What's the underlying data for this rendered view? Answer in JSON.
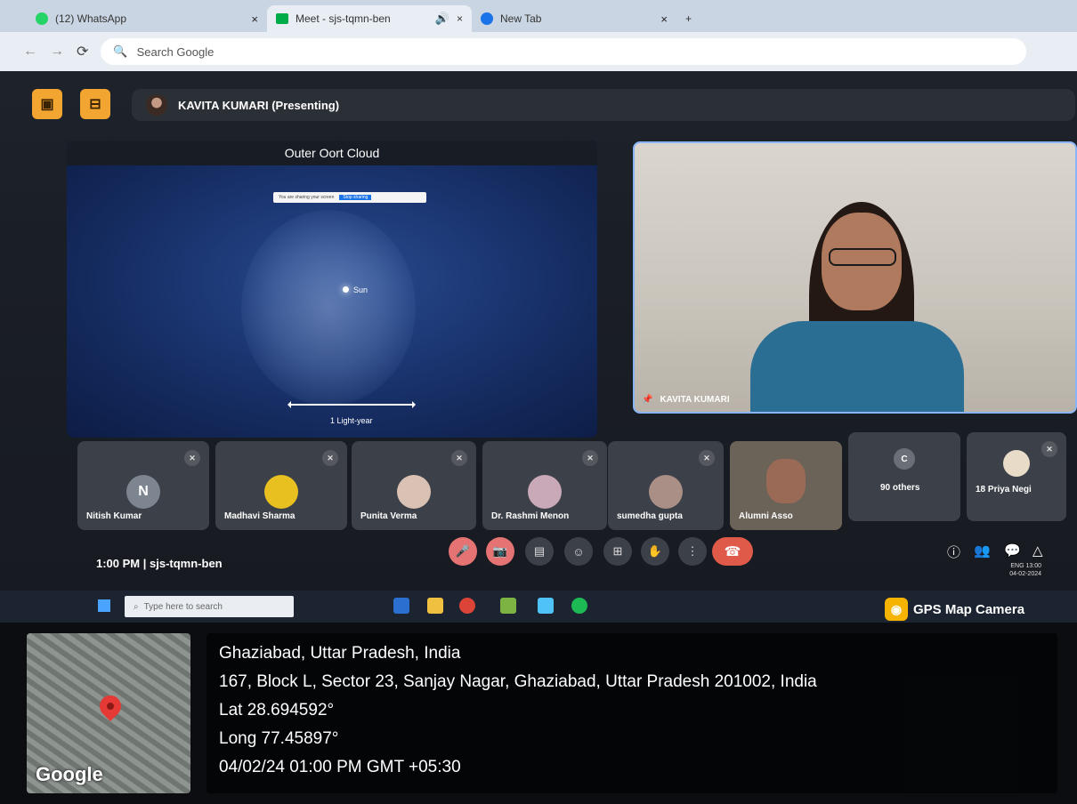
{
  "browser": {
    "tabs": [
      {
        "title": "(12) WhatsApp",
        "close": "×"
      },
      {
        "title": "Meet - sjs-tqmn-ben",
        "close": "×"
      },
      {
        "title": "New Tab",
        "close": "×"
      }
    ],
    "new_tab": "+",
    "search_placeholder": "Search Google"
  },
  "meet": {
    "presenter_label": "KAVITA KUMARI (Presenting)",
    "slide": {
      "title": "Outer Oort Cloud",
      "sun_label": "Sun",
      "scale_label": "1 Light-year",
      "share_banner_text": "You are sharing your screen",
      "share_banner_button": "Stop sharing"
    },
    "main_camera_name": "KAVITA KUMARI",
    "participants": [
      {
        "name": "Nitish Kumar",
        "initial": "N"
      },
      {
        "name": "Madhavi Sharma"
      },
      {
        "name": "Punita Verma"
      },
      {
        "name": "Dr. Rashmi Menon"
      },
      {
        "name": "sumedha gupta"
      },
      {
        "name": "Alumni Asso"
      },
      {
        "name": "90 others",
        "initial": "C"
      },
      {
        "name": "18 Priya Negi"
      }
    ],
    "time": "1:00 PM",
    "meeting_code": "sjs-tqmn-ben",
    "taskbar_search": "Type here to search",
    "sys_time": "13:00",
    "sys_date": "04-02-2024",
    "sys_lang": "ENG"
  },
  "overlay": {
    "badge": "GPS Map Camera",
    "map_label": "Google",
    "location_title": "Ghaziabad, Uttar Pradesh, India",
    "address": "167, Block L, Sector 23, Sanjay Nagar, Ghaziabad, Uttar Pradesh 201002, India",
    "lat": "Lat 28.694592°",
    "long": "Long 77.45897°",
    "datetime": "04/02/24 01:00 PM GMT +05:30"
  }
}
